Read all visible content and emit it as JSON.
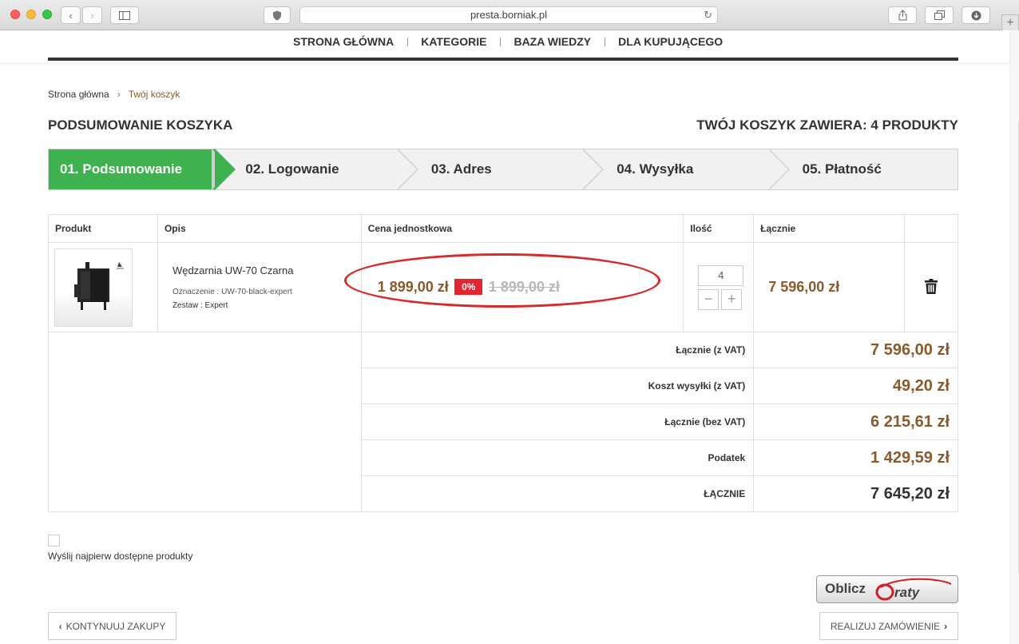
{
  "browser": {
    "url": "presta.borniak.pl"
  },
  "nav": {
    "items": [
      "STRONA GŁÓWNA",
      "KATEGORIE",
      "BAZA WIEDZY",
      "DLA KUPUJĄCEGO"
    ]
  },
  "breadcrumb": {
    "home": "Strona główna",
    "current": "Twój koszyk"
  },
  "page": {
    "title": "PODSUMOWANIE KOSZYKA",
    "cart_count": "TWÓJ KOSZYK ZAWIERA: 4 PRODUKTY"
  },
  "steps": [
    "01. Podsumowanie",
    "02. Logowanie",
    "03. Adres",
    "04. Wysyłka",
    "05. Płatność"
  ],
  "table": {
    "headers": {
      "product": "Produkt",
      "description": "Opis",
      "unit_price": "Cena jednostkowa",
      "quantity": "Ilość",
      "total": "Łącznie"
    },
    "item": {
      "name": "Wędzarnia UW-70 Czarna",
      "sku": "Oznaczenie : UW-70-black-expert",
      "set": "Zestaw : Expert",
      "price": "1 899,00 zł",
      "discount": "0%",
      "old_price": "1 899,00 zł",
      "quantity": "4",
      "total": "7 596,00 zł"
    },
    "summary": [
      {
        "label": "Łącznie (z VAT)",
        "value": "7 596,00 zł"
      },
      {
        "label": "Koszt wysyłki (z VAT)",
        "value": "49,20 zł"
      },
      {
        "label": "Łącznie (bez VAT)",
        "value": "6 215,61 zł"
      },
      {
        "label": "Podatek",
        "value": "1 429,59 zł"
      },
      {
        "label": "ŁĄCZNIE",
        "value": "7 645,20 zł"
      }
    ]
  },
  "checkbox_label": "Wyślij najpierw dostępne produkty",
  "eraty": {
    "label": "Oblicz",
    "logo": "eraty"
  },
  "buttons": {
    "continue": "KONTYNUUJ ZAKUPY",
    "checkout": "REALIZUJ ZAMÓWIENIE"
  },
  "colors": {
    "accent_green": "#3db24f",
    "price_brown": "#8a5a2b",
    "discount_red": "#e4252f",
    "annotation_red": "#d62b2b"
  }
}
